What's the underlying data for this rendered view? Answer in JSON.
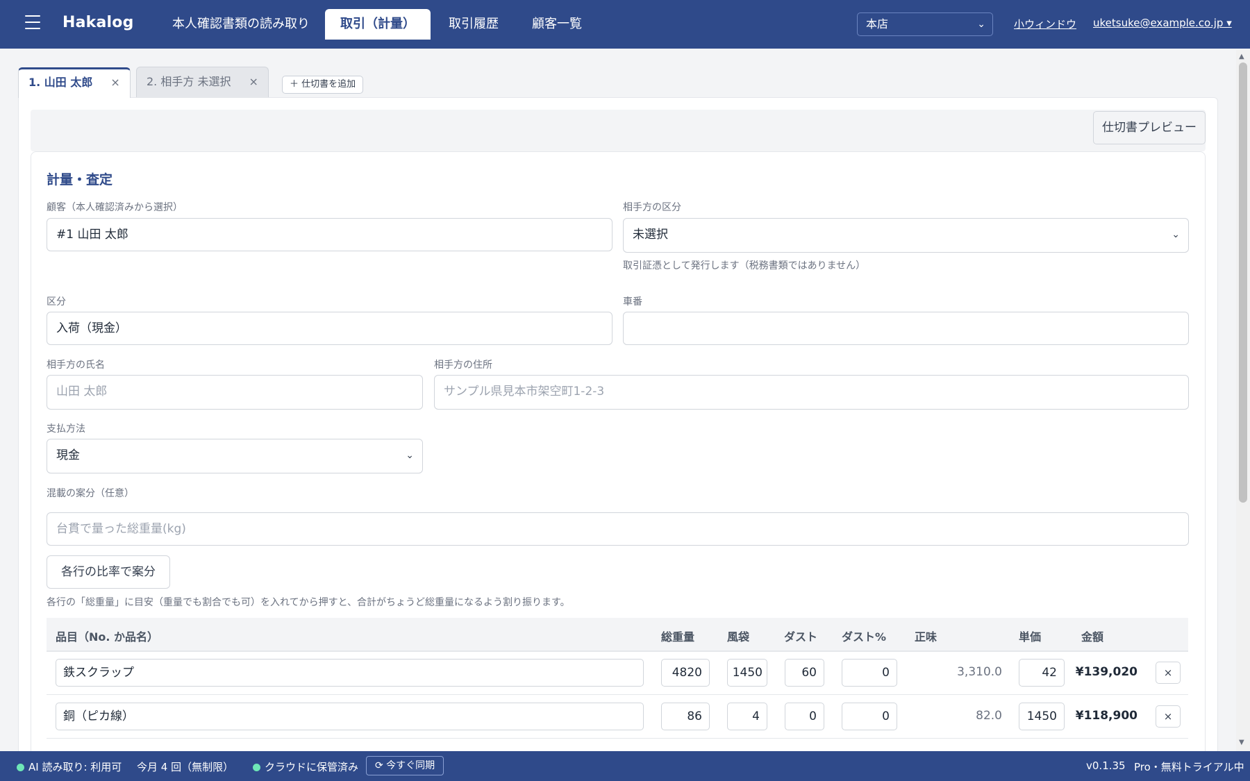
{
  "nav": {
    "brand": "Hakalog",
    "tabs": [
      {
        "label": "本人確認書類の読み取り"
      },
      {
        "label": "取引（計量）"
      },
      {
        "label": "取引履歴"
      },
      {
        "label": "顧客一覧"
      }
    ],
    "store": "本店",
    "small_window": "小ウィンドウ",
    "account": "uketsuke@example.co.jp ▾"
  },
  "doc_tabs": [
    {
      "label": "1. 山田 太郎",
      "close": "×"
    },
    {
      "label": "2. 相手方 未選択",
      "close": "×"
    }
  ],
  "add_doc": "＋ 仕切書を追加",
  "preview_button": "仕切書プレビュー",
  "form": {
    "section_title": "計量・査定",
    "customer_label": "顧客（本人確認済みから選択）",
    "customer_value": "#1 山田 太郎",
    "party_type_label": "相手方の区分",
    "party_type_value": "未選択",
    "party_type_help": "取引証憑として発行します（税務書類ではありません）",
    "category_label": "区分",
    "category_value": "入荷（現金）",
    "vehicle_label": "車番",
    "vehicle_value": "",
    "name_label": "相手方の氏名",
    "name_placeholder": "山田 太郎",
    "address_label": "相手方の住所",
    "address_placeholder": "サンプル県見本市架空町1-2-3",
    "payment_label": "支払方法",
    "payment_value": "現金",
    "mixed_label": "混載の案分（任意）",
    "mixed_placeholder": "台貫で量った総重量(kg)",
    "distribute_button": "各行の比率で案分",
    "distribute_help": "各行の「総重量」に目安（重量でも割合でも可）を入れてから押すと、合計がちょうど総重量になるよう割り振ります。"
  },
  "table": {
    "headers": {
      "item": "品目（No. か品名）",
      "gross": "総重量",
      "bag": "風袋",
      "dust": "ダスト",
      "dust_pct": "ダスト%",
      "net": "正味",
      "unit": "単価",
      "amount": "金額"
    },
    "rows": [
      {
        "item": "鉄スクラップ",
        "gross": "4820",
        "bag": "1450",
        "dust": "60",
        "dust_pct": "0",
        "net": "3,310.0",
        "unit": "42",
        "amount": "¥139,020",
        "remove": "×"
      },
      {
        "item": "銅（ピカ線）",
        "gross": "86",
        "bag": "4",
        "dust": "0",
        "dust_pct": "0",
        "net": "82.0",
        "unit": "1450",
        "amount": "¥118,900",
        "remove": "×"
      }
    ]
  },
  "footer": {
    "ai_status": "AI 読み取り: 利用可",
    "monthly_count": "今月 4 回（無制限）",
    "cloud_status": "クラウドに保管済み",
    "sync_button": "⟳ 今すぐ同期",
    "version": "v0.1.35",
    "plan": "Pro・無料トライアル中"
  },
  "colors": {
    "primary": "#2f4a8a",
    "status_ok": "#6ee7b7"
  }
}
